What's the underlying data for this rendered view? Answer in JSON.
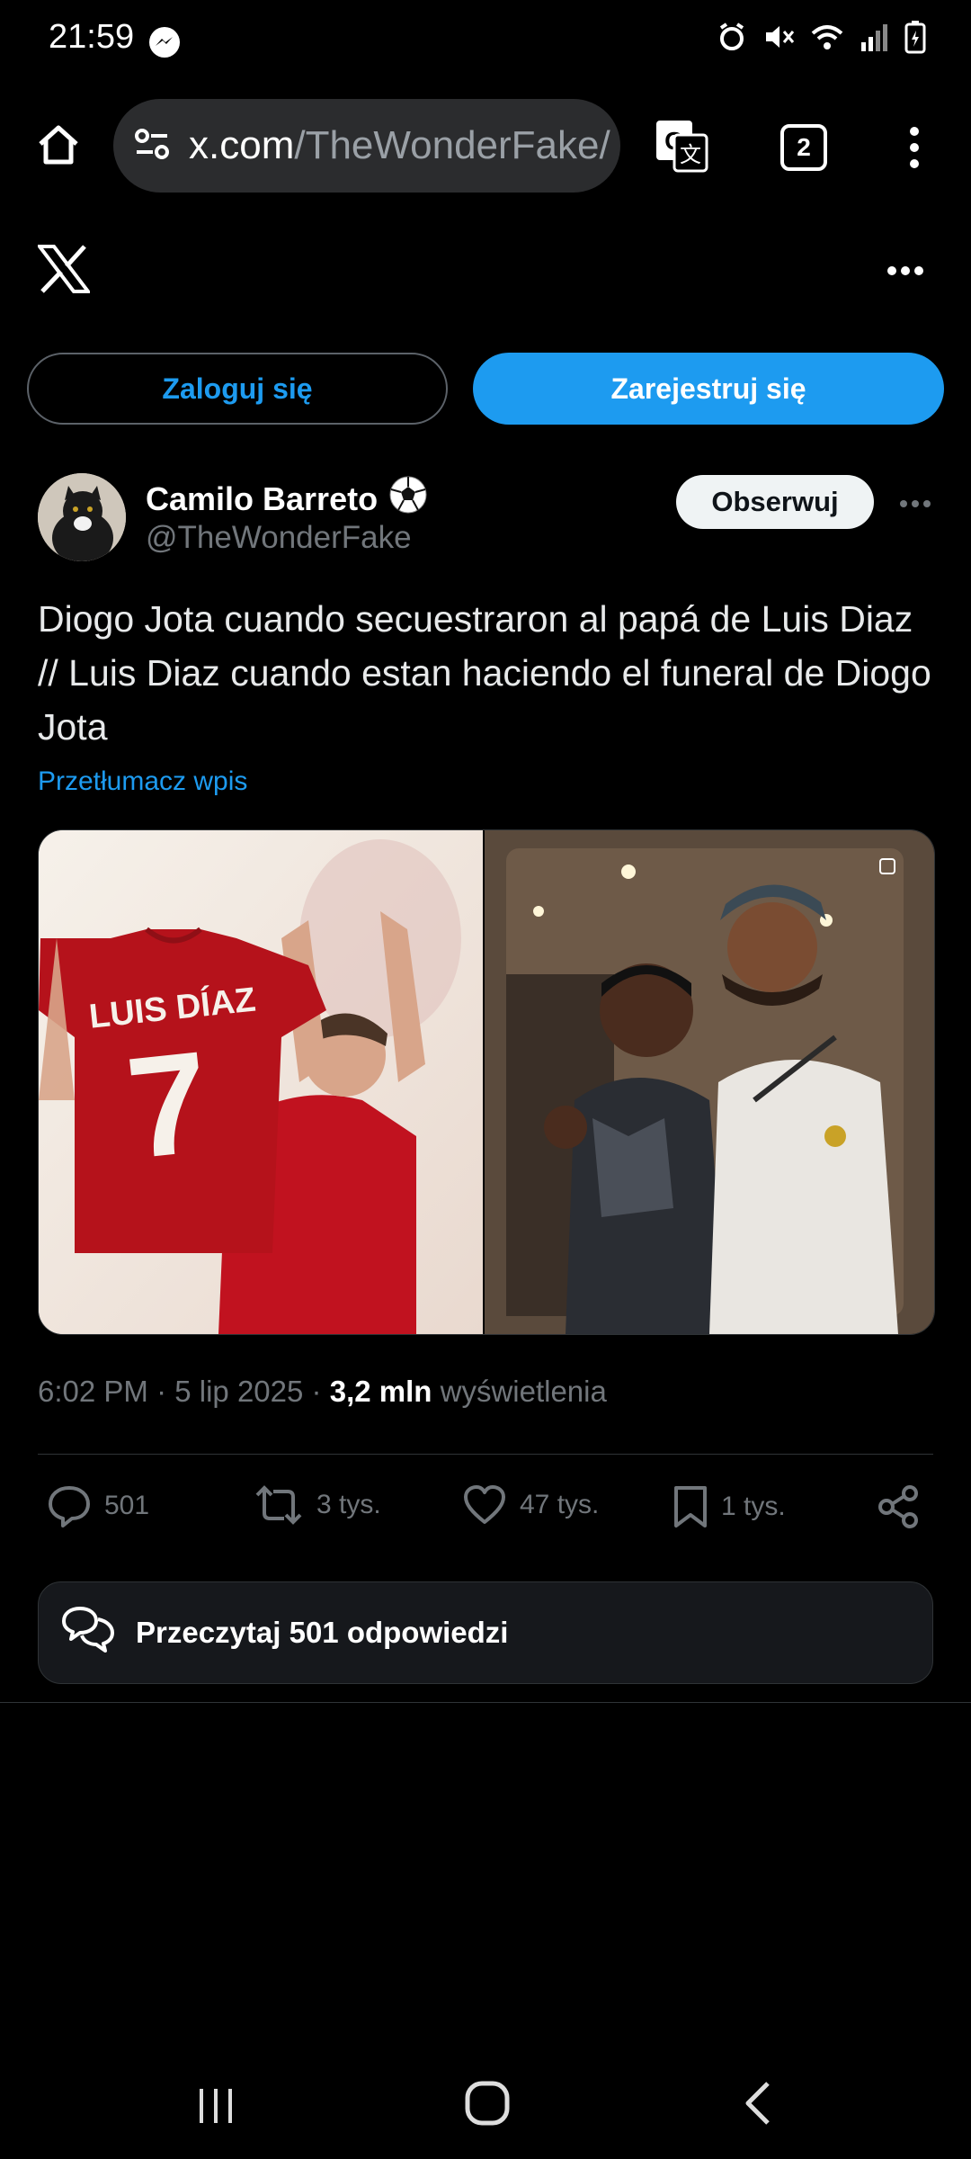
{
  "status_bar": {
    "time": "21:59"
  },
  "browser": {
    "url_domain": "x.com",
    "url_path": "/TheWonderFake/",
    "tab_count": "2"
  },
  "auth": {
    "login_label": "Zaloguj się",
    "signup_label": "Zarejestruj się"
  },
  "tweet": {
    "author_name": "Camilo Barreto",
    "author_handle": "@TheWonderFake",
    "follow_label": "Obserwuj",
    "text": "Diogo Jota cuando secuestraron al papá de Luis Diaz // Luis Diaz cuando estan haciendo el funeral de Diogo Jota",
    "translate_label": "Przetłumacz wpis",
    "image_left": {
      "jersey_name": "LUIS DÍAZ",
      "jersey_number": "7"
    },
    "time": "6:02 PM",
    "date": "5 lip 2025",
    "views_value": "3,2 mln",
    "views_label": "wyświetlenia",
    "reply_count": "501",
    "retweet_count": "3 tys.",
    "like_count": "47 tys.",
    "bookmark_count": "1 tys.",
    "read_replies_label": "Przeczytaj 501 odpowiedzi"
  },
  "colors": {
    "accent": "#1d9bf0",
    "background": "#000000",
    "muted": "#71767b"
  }
}
